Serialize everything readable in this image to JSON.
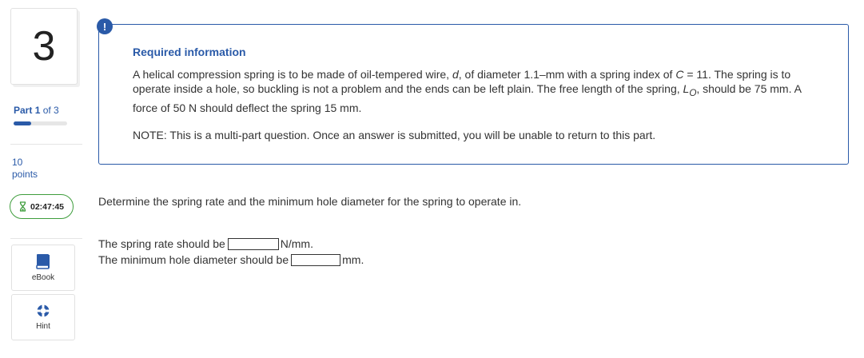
{
  "sidebar": {
    "question_number": "3",
    "part_label": "Part",
    "part_current": "1",
    "part_of": "of 3",
    "progress_fraction": 0.33,
    "points_value": "10",
    "points_label": "points",
    "timer": "02:47:45",
    "tools": [
      {
        "label": "eBook",
        "icon": "book-icon"
      },
      {
        "label": "Hint",
        "icon": "lifebuoy-icon"
      }
    ]
  },
  "info": {
    "alert_symbol": "!",
    "title": "Required information",
    "body": {
      "t1": "A helical compression spring is to be made of oil-tempered wire, ",
      "d": "d",
      "t2": ", of diameter 1.1–mm with a spring index of ",
      "c": "C",
      "t3": " = 11. The spring is to operate inside a hole, so buckling is not a problem and the ends can be left plain. The free length of the spring, ",
      "lo_main": "L",
      "lo_sub": "O",
      "t4": ", should be 75 mm. A force of 50 N should deflect the spring 15 mm."
    },
    "note": "NOTE: This is a multi-part question. Once an answer is submitted, you will be unable to return to this part."
  },
  "question": {
    "prompt": "Determine the spring rate and the minimum hole diameter for the spring to operate in.",
    "answers": [
      {
        "prefix": "The spring rate should be",
        "value": "",
        "unit": "N/mm."
      },
      {
        "prefix": "The minimum hole diameter should be",
        "value": "",
        "unit": "mm."
      }
    ]
  },
  "colors": {
    "accent": "#2a5aa8",
    "timer_border": "#3e9d3c"
  }
}
